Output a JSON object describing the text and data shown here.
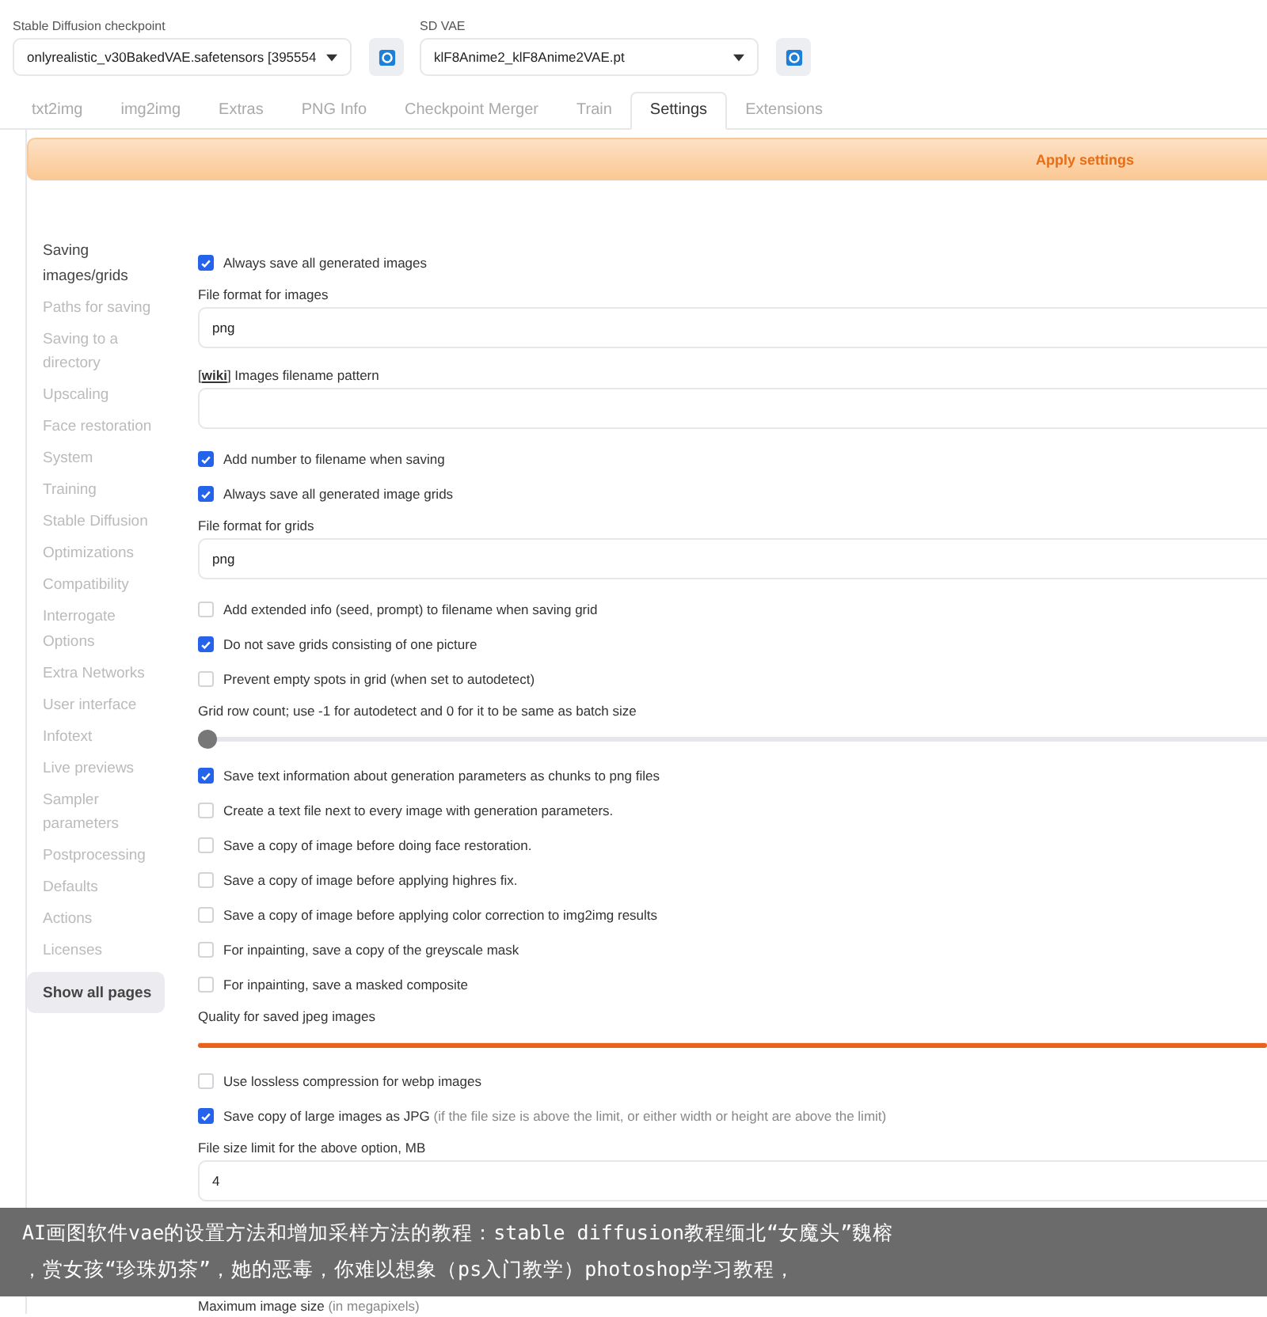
{
  "models": [
    {
      "label": "Stable Diffusion checkpoint",
      "value": "onlyrealistic_v30BakedVAE.safetensors [395554"
    },
    {
      "label": "SD VAE",
      "value": "klF8Anime2_klF8Anime2VAE.pt"
    }
  ],
  "tabs": [
    {
      "label": "txt2img",
      "selected": false
    },
    {
      "label": "img2img",
      "selected": false
    },
    {
      "label": "Extras",
      "selected": false
    },
    {
      "label": "PNG Info",
      "selected": false
    },
    {
      "label": "Checkpoint Merger",
      "selected": false
    },
    {
      "label": "Train",
      "selected": false
    },
    {
      "label": "Settings",
      "selected": true
    },
    {
      "label": "Extensions",
      "selected": false
    }
  ],
  "apply_button": "Apply settings",
  "sidebar": {
    "items": [
      {
        "label": "Saving images/grids",
        "selected": true
      },
      {
        "label": "Paths for saving",
        "selected": false
      },
      {
        "label": "Saving to a directory",
        "selected": false
      },
      {
        "label": "Upscaling",
        "selected": false
      },
      {
        "label": "Face restoration",
        "selected": false
      },
      {
        "label": "System",
        "selected": false
      },
      {
        "label": "Training",
        "selected": false
      },
      {
        "label": "Stable Diffusion",
        "selected": false
      },
      {
        "label": "Optimizations",
        "selected": false
      },
      {
        "label": "Compatibility",
        "selected": false
      },
      {
        "label": "Interrogate Options",
        "selected": false
      },
      {
        "label": "Extra Networks",
        "selected": false
      },
      {
        "label": "User interface",
        "selected": false
      },
      {
        "label": "Infotext",
        "selected": false
      },
      {
        "label": "Live previews",
        "selected": false
      },
      {
        "label": "Sampler parameters",
        "selected": false
      },
      {
        "label": "Postprocessing",
        "selected": false
      },
      {
        "label": "Defaults",
        "selected": false
      },
      {
        "label": "Actions",
        "selected": false
      },
      {
        "label": "Licenses",
        "selected": false
      }
    ],
    "show_all_button": "Show all pages"
  },
  "settings": [
    {
      "kind": "checkbox",
      "label": "Always save all generated images",
      "checked": true
    },
    {
      "kind": "field",
      "label": "File format for images",
      "value": "png"
    },
    {
      "kind": "field",
      "link_before": "[",
      "link": "wiki",
      "link_after": "]",
      "label": "Images filename pattern"
    },
    {
      "kind": "checkbox",
      "label": "Add number to filename when saving",
      "checked": true
    },
    {
      "kind": "checkbox",
      "label": "Always save all generated image grids",
      "checked": true
    },
    {
      "kind": "field",
      "label": "File format for grids",
      "value": "png"
    },
    {
      "kind": "checkbox",
      "label": "Add extended info (seed, prompt) to filename when saving grid",
      "checked": false
    },
    {
      "kind": "checkbox",
      "label": "Do not save grids consisting of one picture",
      "checked": true
    },
    {
      "kind": "checkbox",
      "label": "Prevent empty spots in grid (when set to autodetect)",
      "checked": false
    },
    {
      "kind": "slider",
      "label": "Grid row count; use -1 for autodetect and 0 for it to be same as batch size",
      "level": 0
    },
    {
      "kind": "checkbox",
      "label": "Save text information about generation parameters as chunks to png files",
      "checked": true
    },
    {
      "kind": "checkbox",
      "label": "Create a text file next to every image with generation parameters.",
      "checked": false
    },
    {
      "kind": "checkbox",
      "label": "Save a copy of image before doing face restoration.",
      "checked": false
    },
    {
      "kind": "checkbox",
      "label": "Save a copy of image before applying highres fix.",
      "checked": false
    },
    {
      "kind": "checkbox",
      "label": "Save a copy of image before applying color correction to img2img results",
      "checked": false
    },
    {
      "kind": "checkbox",
      "label": "For inpainting, save a copy of the greyscale mask",
      "checked": false
    },
    {
      "kind": "checkbox",
      "label": "For inpainting, save a masked composite",
      "checked": false
    },
    {
      "kind": "slider",
      "label": "Quality for saved jpeg images",
      "level": 1
    },
    {
      "kind": "checkbox",
      "label": "Use lossless compression for webp images",
      "checked": false
    },
    {
      "kind": "checkbox",
      "label": "Save copy of large images as JPG",
      "hint": "(if the file size is above the limit, or either width or height are above the limit)",
      "checked": true
    },
    {
      "kind": "field",
      "label": "File size limit for the above option, MB",
      "value": "4"
    },
    {
      "kind": "label",
      "label": "Maximum image size",
      "hint": "(in megapixels)"
    }
  ],
  "caption": {
    "lines": [
      "AI画图软件vae的设置方法和增加采样方法的教程：stable diffusion教程缅北“女魔头”魏榕",
      "，赏女孩“珍珠奶茶”，她的恶毒，你难以想象（ps入门教学）photoshop学习教程，"
    ]
  }
}
